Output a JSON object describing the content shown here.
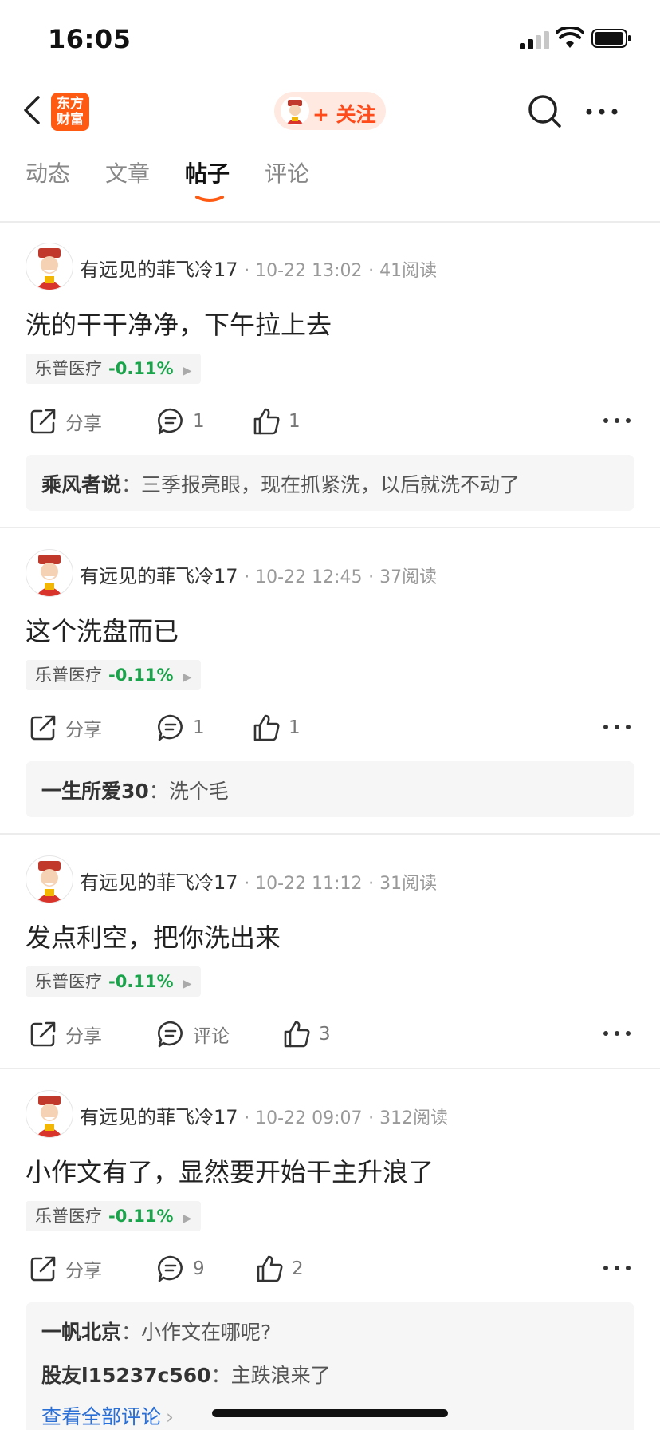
{
  "status": {
    "time": "16:05"
  },
  "nav": {
    "logo_line1": "东方",
    "logo_line2": "财富",
    "follow_label": "+ 关注"
  },
  "tabs": [
    {
      "label": "动态"
    },
    {
      "label": "文章"
    },
    {
      "label": "帖子"
    },
    {
      "label": "评论"
    }
  ],
  "posts": [
    {
      "author": "有远见的菲飞冷17",
      "time": "10-22 13:02",
      "reads": "41阅读",
      "content": "洗的干干净净，下午拉上去",
      "stock": {
        "name": "乐普医疗",
        "change": "-0.11%"
      },
      "share_label": "分享",
      "comment_count": "1",
      "like_count": "1",
      "comments": [
        {
          "user": "乘风者说",
          "text": "三季报亮眼，现在抓紧洗，以后就洗不动了"
        }
      ]
    },
    {
      "author": "有远见的菲飞冷17",
      "time": "10-22 12:45",
      "reads": "37阅读",
      "content": "这个洗盘而已",
      "stock": {
        "name": "乐普医疗",
        "change": "-0.11%"
      },
      "share_label": "分享",
      "comment_count": "1",
      "like_count": "1",
      "comments": [
        {
          "user": "一生所爱30",
          "text": "洗个毛"
        }
      ]
    },
    {
      "author": "有远见的菲飞冷17",
      "time": "10-22 11:12",
      "reads": "31阅读",
      "content": "发点利空，把你洗出来",
      "stock": {
        "name": "乐普医疗",
        "change": "-0.11%"
      },
      "share_label": "分享",
      "comment_count": "评论",
      "like_count": "3",
      "comments": []
    },
    {
      "author": "有远见的菲飞冷17",
      "time": "10-22 09:07",
      "reads": "312阅读",
      "content": "小作文有了，显然要开始干主升浪了",
      "stock": {
        "name": "乐普医疗",
        "change": "-0.11%"
      },
      "share_label": "分享",
      "comment_count": "9",
      "like_count": "2",
      "comments": [
        {
          "user": "一帆北京",
          "text": "小作文在哪呢?"
        },
        {
          "user": "股友l15237c560",
          "text": "主跌浪来了"
        }
      ],
      "view_all": "查看全部评论"
    }
  ],
  "colors": {
    "accent": "#ff5a12",
    "positive_green": "#1aa34a",
    "link_blue": "#2a6fd6"
  }
}
